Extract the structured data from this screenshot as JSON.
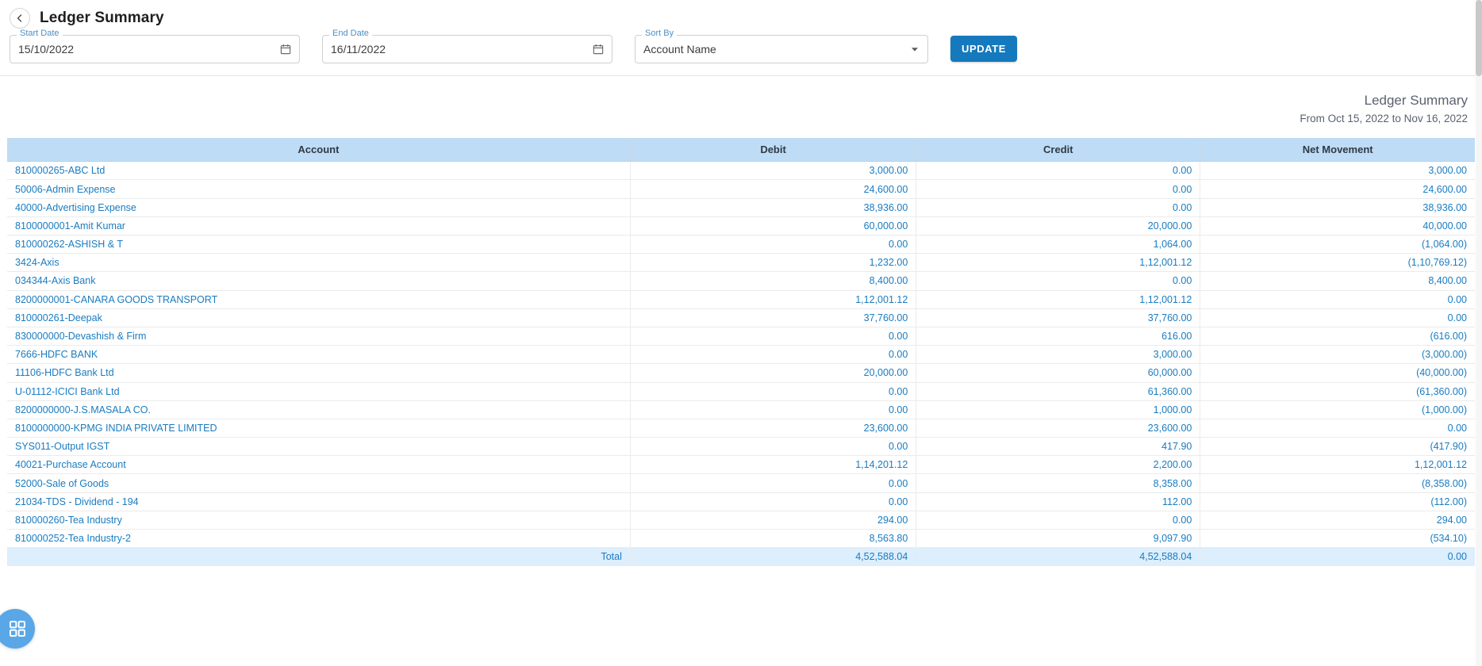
{
  "header": {
    "back_icon": "chevron-left-icon",
    "title": "Ledger Summary"
  },
  "filters": {
    "start_date": {
      "label": "Start Date",
      "value": "15/10/2022",
      "icon": "calendar-icon"
    },
    "end_date": {
      "label": "End Date",
      "value": "16/11/2022",
      "icon": "calendar-icon"
    },
    "sort_by": {
      "label": "Sort By",
      "value": "Account Name",
      "icon": "chevron-down-icon"
    },
    "update_button": "UPDATE"
  },
  "report": {
    "title": "Ledger Summary",
    "range": "From Oct 15, 2022 to Nov 16, 2022"
  },
  "table": {
    "columns": [
      "Account",
      "Debit",
      "Credit",
      "Net Movement"
    ],
    "rows": [
      {
        "account": "810000265-ABC Ltd",
        "debit": "3,000.00",
        "credit": "0.00",
        "net": "3,000.00"
      },
      {
        "account": "50006-Admin Expense",
        "debit": "24,600.00",
        "credit": "0.00",
        "net": "24,600.00"
      },
      {
        "account": "40000-Advertising Expense",
        "debit": "38,936.00",
        "credit": "0.00",
        "net": "38,936.00"
      },
      {
        "account": "8100000001-Amit Kumar",
        "debit": "60,000.00",
        "credit": "20,000.00",
        "net": "40,000.00"
      },
      {
        "account": "810000262-ASHISH & T",
        "debit": "0.00",
        "credit": "1,064.00",
        "net": "(1,064.00)"
      },
      {
        "account": "3424-Axis",
        "debit": "1,232.00",
        "credit": "1,12,001.12",
        "net": "(1,10,769.12)"
      },
      {
        "account": "034344-Axis Bank",
        "debit": "8,400.00",
        "credit": "0.00",
        "net": "8,400.00"
      },
      {
        "account": "8200000001-CANARA GOODS TRANSPORT",
        "debit": "1,12,001.12",
        "credit": "1,12,001.12",
        "net": "0.00"
      },
      {
        "account": "810000261-Deepak",
        "debit": "37,760.00",
        "credit": "37,760.00",
        "net": "0.00"
      },
      {
        "account": "830000000-Devashish & Firm",
        "debit": "0.00",
        "credit": "616.00",
        "net": "(616.00)"
      },
      {
        "account": "7666-HDFC BANK",
        "debit": "0.00",
        "credit": "3,000.00",
        "net": "(3,000.00)"
      },
      {
        "account": "11106-HDFC Bank Ltd",
        "debit": "20,000.00",
        "credit": "60,000.00",
        "net": "(40,000.00)"
      },
      {
        "account": "U-01112-ICICI Bank Ltd",
        "debit": "0.00",
        "credit": "61,360.00",
        "net": "(61,360.00)"
      },
      {
        "account": "8200000000-J.S.MASALA CO.",
        "debit": "0.00",
        "credit": "1,000.00",
        "net": "(1,000.00)"
      },
      {
        "account": "8100000000-KPMG INDIA PRIVATE LIMITED",
        "debit": "23,600.00",
        "credit": "23,600.00",
        "net": "0.00"
      },
      {
        "account": "SYS011-Output IGST",
        "debit": "0.00",
        "credit": "417.90",
        "net": "(417.90)"
      },
      {
        "account": "40021-Purchase Account",
        "debit": "1,14,201.12",
        "credit": "2,200.00",
        "net": "1,12,001.12"
      },
      {
        "account": "52000-Sale of Goods",
        "debit": "0.00",
        "credit": "8,358.00",
        "net": "(8,358.00)"
      },
      {
        "account": "21034-TDS - Dividend - 194",
        "debit": "0.00",
        "credit": "112.00",
        "net": "(112.00)"
      },
      {
        "account": "810000260-Tea Industry",
        "debit": "294.00",
        "credit": "0.00",
        "net": "294.00"
      },
      {
        "account": "810000252-Tea Industry-2",
        "debit": "8,563.80",
        "credit": "9,097.90",
        "net": "(534.10)"
      }
    ],
    "total": {
      "label": "Total",
      "debit": "4,52,588.04",
      "credit": "4,52,588.04",
      "net": "0.00"
    }
  },
  "fab": {
    "icon": "grid-apps-icon"
  },
  "colors": {
    "accent": "#1579bd",
    "link": "#1a7cc0",
    "table_header_bg": "#bedcf5",
    "total_row_bg": "#ddeefc",
    "fab_bg": "#5aa7e8"
  }
}
